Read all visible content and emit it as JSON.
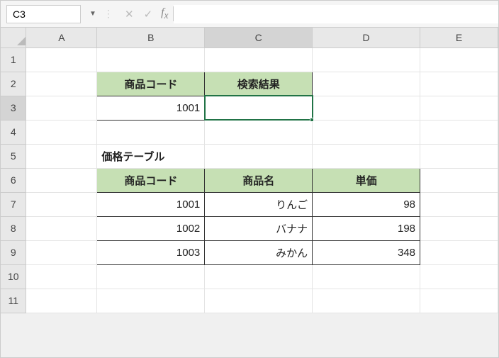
{
  "nameBox": "C3",
  "formulaInput": "",
  "columns": [
    "A",
    "B",
    "C",
    "D",
    "E"
  ],
  "rows": [
    "1",
    "2",
    "3",
    "4",
    "5",
    "6",
    "7",
    "8",
    "9",
    "10",
    "11"
  ],
  "activeCell": {
    "row": 3,
    "col": "C"
  },
  "lookup": {
    "b2": "商品コード",
    "c2": "検索結果",
    "b3": "1001"
  },
  "tableTitle": "価格テーブル",
  "tableHeaders": {
    "b6": "商品コード",
    "c6": "商品名",
    "d6": "単価"
  },
  "tableRows": [
    {
      "code": "1001",
      "name": "りんご",
      "price": "98"
    },
    {
      "code": "1002",
      "name": "バナナ",
      "price": "198"
    },
    {
      "code": "1003",
      "name": "みかん",
      "price": "348"
    }
  ],
  "colors": {
    "headerFill": "#c6e0b4",
    "selection": "#217346"
  }
}
